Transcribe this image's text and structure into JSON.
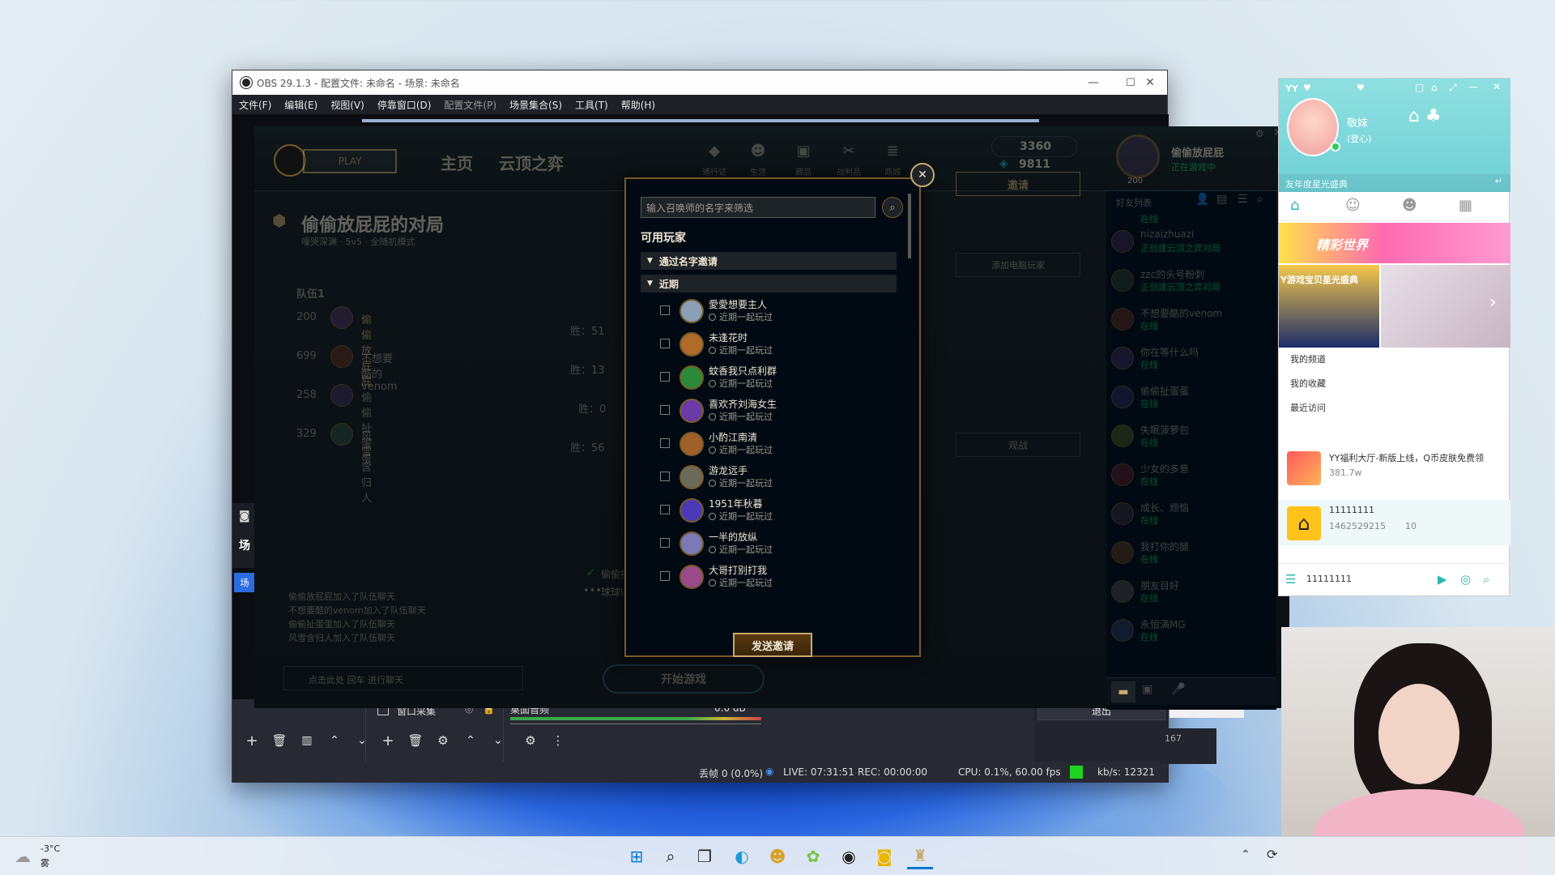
{
  "obs": {
    "title": "OBS 29.1.3 - 配置文件: 未命名 - 场景: 未命名",
    "menu": [
      "文件(F)",
      "编辑(E)",
      "视图(V)",
      "停靠窗口(D)",
      "配置文件(P)",
      "场景集合(S)",
      "工具(T)",
      "帮助(H)"
    ],
    "sources_item": "窗口采集",
    "audio_label": "桌面音频",
    "audio_db": "0.0 dB",
    "exit_button": "退出",
    "side_count": "167",
    "status": {
      "dropped": "丢帧 0 (0.0%)",
      "live": "LIVE: 07:31:51",
      "rec": "REC: 00:00:00",
      "cpu": "CPU: 0.1%, 60.00 fps",
      "kbs": "kb/s: 12321"
    },
    "scene_label_1": "场",
    "scene_label_2": "场"
  },
  "lol": {
    "play_button": "PLAY",
    "tabs": [
      "主页",
      "云顶之弈"
    ],
    "nav_icons": [
      "通行证",
      "生涯",
      "藏品",
      "战利品",
      "商城"
    ],
    "currency_rp": "3360",
    "currency_be": "9811",
    "profile_name": "偷偷放屁屁",
    "profile_status": "正在游戏中",
    "profile_level": "200",
    "lobby_title": "偷偷放屁屁的对局",
    "lobby_sub": "嚎哭深渊 · 5v5 · 全随机模式",
    "team_label": "队伍1",
    "team": [
      {
        "level": "200",
        "name": "偷偷放屁屁"
      },
      {
        "level": "699",
        "name": "不想要酷的venom"
      },
      {
        "level": "258",
        "name": "偷偷扯蛋蛋"
      },
      {
        "level": "329",
        "name": "风雪含归人"
      }
    ],
    "team_stats": [
      "胜：51",
      "胜：13",
      "胜：0",
      "胜：56"
    ],
    "invite_button": "邀请",
    "add_bot_button": "添加电脑玩家",
    "spectate_button": "观战",
    "start_button": "开始游戏",
    "chat_lines": [
      "偷偷放屁屁加入了队伍聊天",
      "不想要酷的venom加入了队伍聊天",
      "偷偷扯蛋蛋加入了队伍聊天",
      "风雪含归人加入了队伍聊天"
    ],
    "chat_placeholder": "点击此处  回车  进行聊天",
    "lobby_chat_user": "偷偷扯",
    "lobby_chat_user2": "球球Uv!",
    "friends_header": "好友列表",
    "friends": [
      {
        "name": "nizaizhuazi",
        "status": "正创建云顶之弈对局"
      },
      {
        "name": "zzc的头号粉刺",
        "status": "正创建云顶之弈对局"
      },
      {
        "name": "不想要酷的venom",
        "status": "在线"
      },
      {
        "name": "你在等什么吗",
        "status": "在线"
      },
      {
        "name": "偷偷扯蛋蛋",
        "status": "在线"
      },
      {
        "name": "失眠菠萝包",
        "status": "在线"
      },
      {
        "name": "少女的多意",
        "status": "在线"
      },
      {
        "name": "成长、烦恼",
        "status": "在线"
      },
      {
        "name": "我打你的腿",
        "status": "在线"
      },
      {
        "name": "朋友目好",
        "status": "在线"
      },
      {
        "name": "永恒满MG",
        "status": "在线"
      }
    ],
    "friends_top_status": "在线"
  },
  "dialog": {
    "search_placeholder": "输入召唤师的名字来筛选",
    "available_title": "可用玩家",
    "by_name_section": "通过名字邀请",
    "recent_section": "近期",
    "recent_label": "近期一起玩过",
    "players": [
      "愛愛想要主人",
      "未逢花时",
      "蚊香我只点利群",
      "喜欢齐刘海女生",
      "小酌江南清",
      "游龙远手",
      "1951年秋暮",
      "一半的放纵",
      "大哥打别打我"
    ],
    "send_button": "发送邀请"
  },
  "yy": {
    "logo": "YY",
    "user_name": "敬妹",
    "user_sub": "(登心)",
    "banner_text": "精彩世界",
    "banner_event": "Y游戏宝贝星光盛典",
    "search_hint": "友年度星光盛典",
    "links": [
      "我的频道",
      "我的收藏",
      "最近访问"
    ],
    "recent_items": [
      {
        "title": "YY福利大厅-新版上线，Q币皮肤免费领",
        "count": "381.7w"
      },
      {
        "title": "11111111",
        "id": "1462529215",
        "count": "10"
      }
    ],
    "footer_text": "11111111"
  },
  "taskbar": {
    "weather_temp": "-3°C",
    "weather_desc": "雾"
  },
  "colors": {
    "lol_gold": "#c8aa6e",
    "lol_green": "#0acb67",
    "obs_dark": "#2b2e38",
    "yy_teal": "#2db7b0"
  }
}
